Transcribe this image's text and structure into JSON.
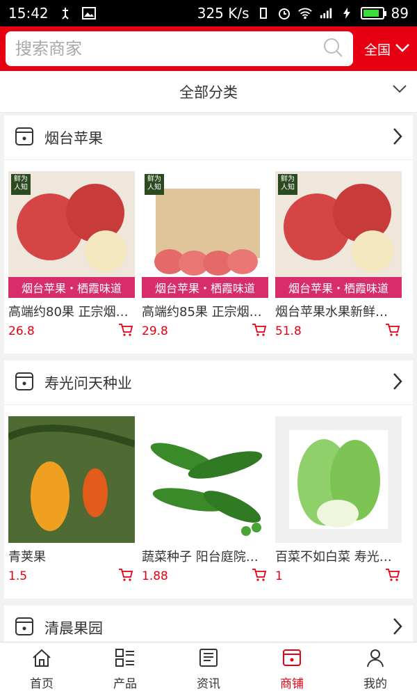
{
  "status_bar": {
    "time": "15:42",
    "network_speed": "325 K/s",
    "battery": "89",
    "icons": [
      "usb-icon",
      "image-icon",
      "vibrate-icon",
      "alarm-icon",
      "wifi-icon",
      "signal-4g-icon",
      "charging-icon",
      "battery-icon"
    ]
  },
  "header": {
    "search_placeholder": "搜索商家",
    "region": "全国",
    "accent_color": "#e60012"
  },
  "categories": {
    "label": "全部分类"
  },
  "shops": [
    {
      "name": "烟台苹果",
      "products": [
        {
          "name": "高端约80果 正宗烟…",
          "price": "26.8",
          "banner": "烟台苹果・栖霞味道"
        },
        {
          "name": "高端约85果 正宗烟…",
          "price": "29.8",
          "banner": "烟台苹果・栖霞味道"
        },
        {
          "name": "烟台苹果水果新鲜…",
          "price": "51.8",
          "banner": "烟台苹果・栖霞味道"
        }
      ]
    },
    {
      "name": "寿光问天种业",
      "products": [
        {
          "name": "青荚果",
          "price": "1.5"
        },
        {
          "name": "蔬菜种子 阳台庭院…",
          "price": "1.88"
        },
        {
          "name": "百菜不如白菜 寿光…",
          "price": "1"
        }
      ]
    },
    {
      "name": "清晨果园",
      "products": []
    }
  ],
  "tabs": [
    {
      "label": "首页",
      "icon": "home-icon"
    },
    {
      "label": "产品",
      "icon": "list-icon"
    },
    {
      "label": "资讯",
      "icon": "news-icon"
    },
    {
      "label": "商铺",
      "icon": "shop-icon",
      "active": true
    },
    {
      "label": "我的",
      "icon": "user-icon"
    }
  ]
}
